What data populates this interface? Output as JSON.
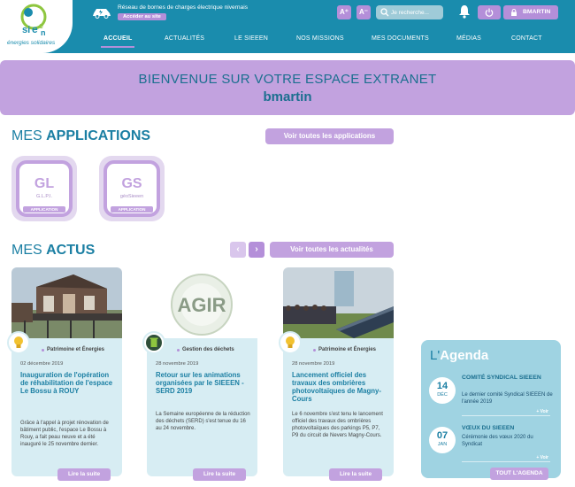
{
  "header": {
    "logo_text": "énergies solidaires",
    "charge_text": "Réseau de bornes de charges électrique nivernais",
    "access_label": "Accéder au site",
    "font_plus": "A⁺",
    "font_minus": "A⁻",
    "search_placeholder": "Je recherche...",
    "user_label": "BMARTIN"
  },
  "nav": {
    "items": [
      "ACCUEIL",
      "ACTUALITÉS",
      "LE SIEEEN",
      "NOS MISSIONS",
      "MES DOCUMENTS",
      "MÉDIAS",
      "CONTACT"
    ],
    "active": "ACCUEIL"
  },
  "welcome": {
    "title": "BIENVENUE SUR VOTRE ESPACE EXTRANET",
    "user": "bmartin"
  },
  "applications": {
    "title_light": "MES ",
    "title_bold": "APPLICATIONS",
    "see_all": "Voir toutes les applications",
    "tiles": [
      {
        "code": "GL",
        "sub": "G.L.P.I.",
        "label": "APPLICATION"
      },
      {
        "code": "GS",
        "sub": "géoSieeen",
        "label": "APPLICATION"
      }
    ]
  },
  "actus": {
    "title_light": "MES ",
    "title_bold": "ACTUS",
    "prev": "‹",
    "next": "›",
    "see_all": "Voir toutes les actualités",
    "cards": [
      {
        "category": "Patrimoine et Énergies",
        "date": "02 décembre 2019",
        "title": "Inauguration de l'opération de réhabilitation de l'espace Le Bossu à ROUY",
        "text": "Grâce à l'appel à projet rénovation de bâtiment public, l'espace Le Bossu à Rouy, a fait peau neuve et a été inauguré le 25 novembre dernier.",
        "more": "Lire la suite"
      },
      {
        "category": "Gestion des déchets",
        "date": "28 novembre 2019",
        "title": "Retour sur les animations organisées par le SIEEEN - SERD 2019",
        "text": "La Semaine européenne de la réduction des déchets (SERD) s'est tenue du 16 au 24 novembre.",
        "more": "Lire la suite",
        "image_text": "AGIR"
      },
      {
        "category": "Patrimoine et Énergies",
        "date": "28 novembre 2019",
        "title": "Lancement officiel des travaux des ombrières photovoltaïques de Magny-Cours",
        "text": "Le 6 novembre s'est tenu le lancement officiel des travaux des ombrières photovoltaïques des parkings P5, P7, P9 du circuit de Nevers Magny-Cours.",
        "more": "Lire la suite"
      }
    ]
  },
  "agenda": {
    "title_prefix": "L'",
    "title": "Agenda",
    "events": [
      {
        "day": "14",
        "month": "DÉC",
        "title": "COMITÉ SYNDICAL SIEEEN",
        "desc": "Le dernier comité Syndical SIEEEN de l'année 2019",
        "more": "+ Voir"
      },
      {
        "day": "07",
        "month": "JAN",
        "title": "VŒUX DU SIEEEN",
        "desc": "Cérémonie des vœux 2020 du Syndicat",
        "more": "+ Voir"
      }
    ],
    "all_label": "TOUT L'AGENDA"
  },
  "colors": {
    "header_blue": "#1a8cad",
    "accent_purple": "#c2a2df",
    "title_blue": "#1b7fa3",
    "card_bg": "#d7edf3",
    "agenda_bg": "#9fd3e2"
  }
}
